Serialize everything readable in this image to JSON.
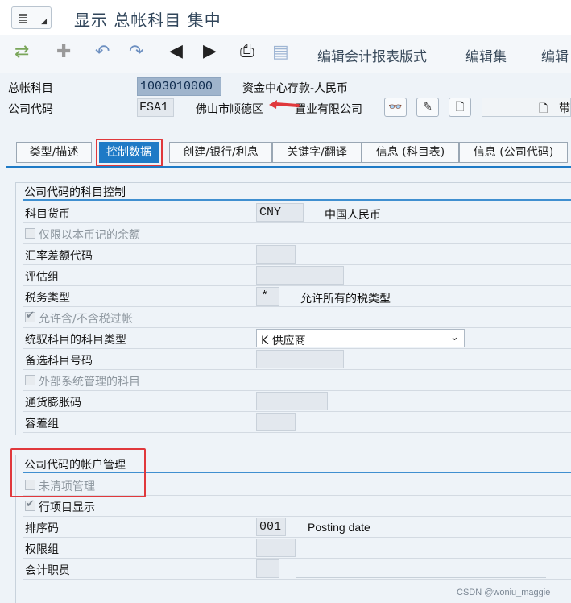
{
  "window": {
    "title": "显示 总帐科目 集中"
  },
  "toolbar": {
    "edit_report_format": "编辑会计报表版式",
    "edit_set": "编辑集",
    "edit_more": "编辑"
  },
  "header": {
    "gl_account_label": "总帐科目",
    "gl_account_value": "1003010000",
    "gl_account_desc": "资金中心存款-人民币",
    "company_code_label": "公司代码",
    "company_code_value": "FSA1",
    "company_name": "佛山市顺德区",
    "company_name_tail": "置业有限公司",
    "right_field_text": "带"
  },
  "tabs": [
    {
      "label": "类型/描述"
    },
    {
      "label": "控制数据"
    },
    {
      "label": "创建/银行/利息"
    },
    {
      "label": "关键字/翻译"
    },
    {
      "label": "信息 (科目表)"
    },
    {
      "label": "信息 (公司代码)"
    }
  ],
  "account_control": {
    "group_title": "公司代码的科目控制",
    "currency_label": "科目货币",
    "currency_value": "CNY",
    "currency_desc": "中国人民币",
    "local_currency_only_label": "仅限以本币记的余额",
    "local_currency_only_checked": false,
    "exchange_diff_label": "汇率差额代码",
    "valuation_group_label": "评估组",
    "tax_category_label": "税务类型",
    "tax_category_value": "*",
    "tax_category_desc": "允许所有的税类型",
    "posting_without_tax_label": "允许含/不含税过帐",
    "posting_without_tax_checked": true,
    "recon_account_label": "统驭科目的科目类型",
    "recon_account_value": "K 供应商",
    "alt_account_label": "备选科目号码",
    "external_mgmt_label": "外部系统管理的科目",
    "external_mgmt_checked": false,
    "inflation_key_label": "通货膨胀码",
    "tolerance_group_label": "容差组"
  },
  "account_management": {
    "group_title": "公司代码的帐户管理",
    "open_item_label": "未清项管理",
    "open_item_checked": false,
    "line_item_display_label": "行项目显示",
    "line_item_display_checked": true,
    "sort_key_label": "排序码",
    "sort_key_value": "001",
    "sort_key_desc": "Posting date",
    "authorization_group_label": "权限组",
    "accounting_clerk_label": "会计职员"
  },
  "watermark": {
    "credit": "CSDN @woniu_maggie"
  },
  "colors": {
    "accent": "#1e7ac6",
    "highlight_box": "#e0383c",
    "annotation_arrow": "#e0383c"
  }
}
